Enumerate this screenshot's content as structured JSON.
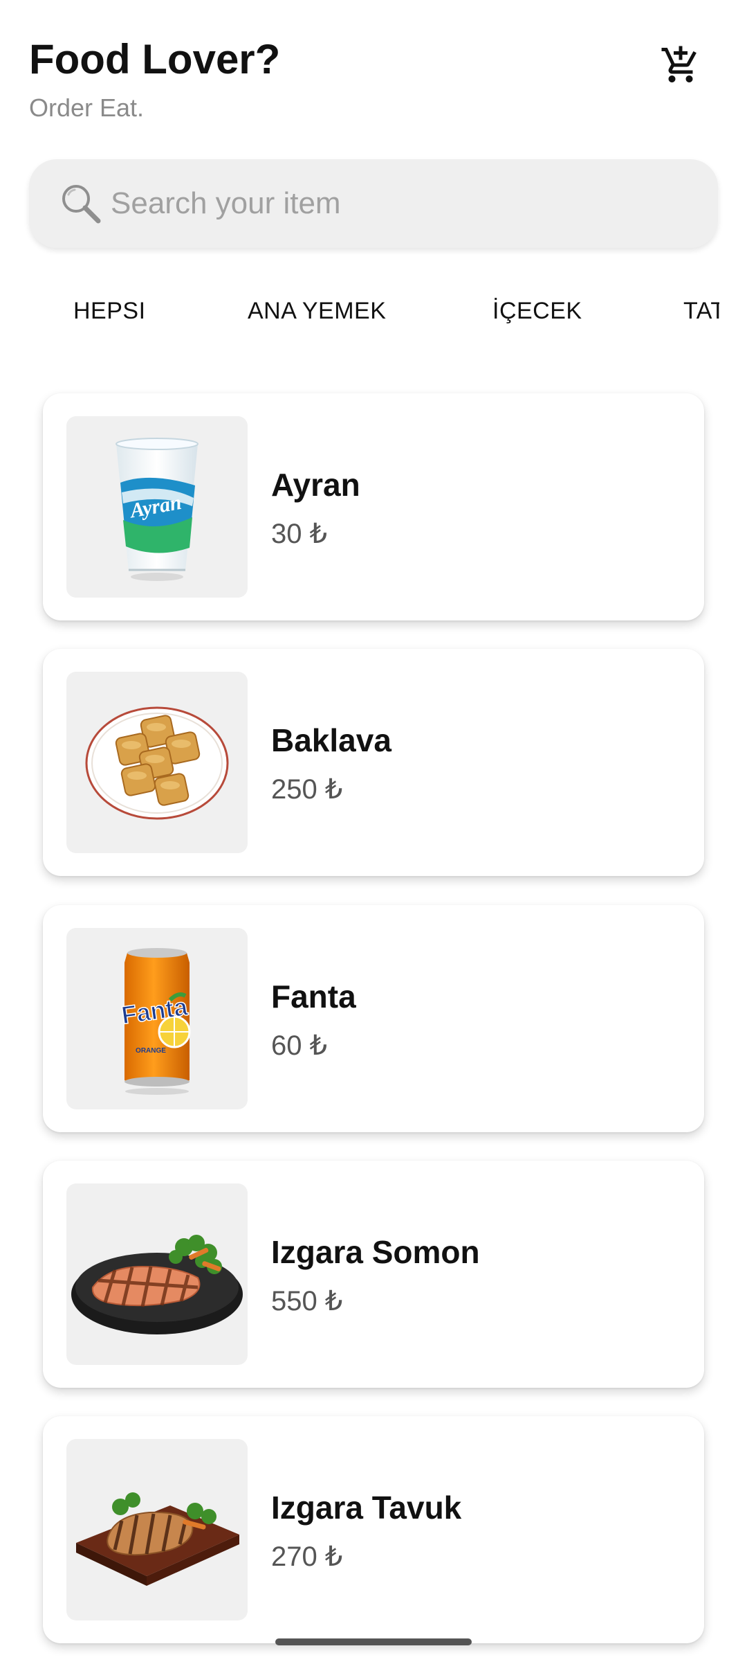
{
  "header": {
    "title": "Food Lover?",
    "subtitle": "Order Eat.",
    "cart_icon": "add-shopping-cart-icon"
  },
  "search": {
    "placeholder": "Search your item",
    "value": "",
    "icon": "magnifier-icon"
  },
  "tabs": [
    {
      "label": "HEPSI"
    },
    {
      "label": "ANA YEMEK"
    },
    {
      "label": "İÇECEK"
    },
    {
      "label": "TATLI"
    }
  ],
  "items": [
    {
      "name": "Ayran",
      "price": "30 ₺",
      "image": "ayran-cup"
    },
    {
      "name": "Baklava",
      "price": "250 ₺",
      "image": "baklava-plate"
    },
    {
      "name": "Fanta",
      "price": "60 ₺",
      "image": "fanta-can"
    },
    {
      "name": "Izgara Somon",
      "price": "550 ₺",
      "image": "grilled-salmon"
    },
    {
      "name": "Izgara Tavuk",
      "price": "270 ₺",
      "image": "grilled-chicken"
    }
  ],
  "colors": {
    "background": "#ffffff",
    "search_bg": "#efefef",
    "thumb_bg": "#f0f0f0",
    "title": "#111111",
    "subtitle": "#8a8a8a",
    "price": "#555555"
  }
}
